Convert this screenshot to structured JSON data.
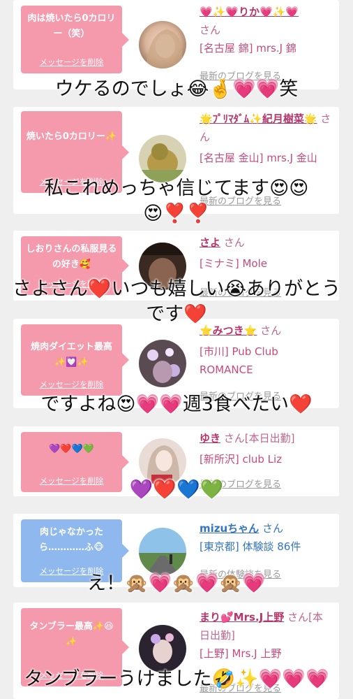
{
  "items": [
    {
      "message": "肉は焼いたら0カロリー（笑）",
      "delete_label": "メッセージを削除",
      "name": "💗✨💗りか💗✨💗",
      "san": "さん",
      "location": "[名古屋 錦] mrs.J 錦",
      "link": "最新のブログを見る",
      "caption": "ウケるのでしょ😂🤞💗💗笑"
    },
    {
      "message": "焼いたら0カロリー✨",
      "delete_label": "メッセージを削除",
      "name": "🌟ﾌﾟﾘﾏﾀﾞﾑ✨紀月樹菜🌟",
      "san": "さん",
      "location": "[名古屋 金山] mrs.J 金山",
      "link": "最新のブログを見る",
      "caption": "私これめっちゃ信じてます😍😍😍❣️❣️"
    },
    {
      "message": "しおりさんの私服見るの好き🥰",
      "delete_label": "メッセージを削除",
      "name": "さよ",
      "san": "さん",
      "location": "[ミナミ] Mole",
      "link": "最新のブログを見る",
      "caption": "さよさん❤️いつも嬉しい😭ありがとうです❤️"
    },
    {
      "message": "焼肉ダイエット最高✨💟✨",
      "delete_label": "メッセージを削除",
      "name": "⭐みつき⭐",
      "san": "さん",
      "location": "[市川] Pub Club ROMANCE",
      "link": "最新のブログを見る",
      "caption": "ですよね😍💗💗週3食べたい❤️"
    },
    {
      "message": "💜❤️💙💚",
      "delete_label": "メッセージを削除",
      "name": "ゆき",
      "san": "さん[本日出勤]",
      "location": "[新所沢] club Liz",
      "link": "最新のブログを見る",
      "caption": "💜❤️💙💚"
    },
    {
      "message": "肉じゃなかったら…………ふ🐵",
      "delete_label": "メッセージを削除",
      "name": "mizuちゃん",
      "san": "さん",
      "location": "[東京都] 体験談 86件",
      "link": "最新の体験談を見る",
      "caption": "え！🙊💗🙊💗🙊💗"
    },
    {
      "message": "タンブラー最高✨😆✨",
      "delete_label": "メッセージを削除",
      "name": "まり💕Mrs.J上野",
      "san": "さん[本日出勤]",
      "location": "[上野] Mrs.J 上野",
      "link": "最新のブログを見る",
      "caption": "タンブラーうけました🤣✨💗💗💗"
    }
  ],
  "colors": {
    "bubble_pink": "#f59aad",
    "bubble_blue": "#8fb8ee",
    "name_pink": "#b4366b",
    "name_blue": "#3374c2",
    "background": "#efefef"
  }
}
